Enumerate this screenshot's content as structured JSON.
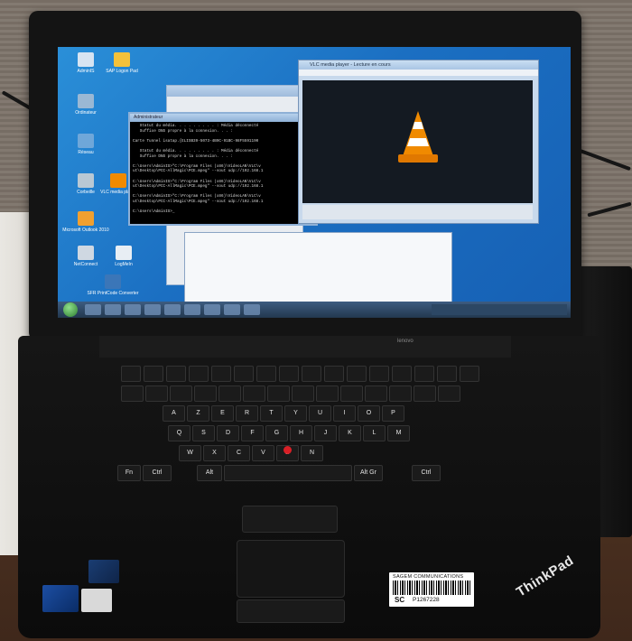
{
  "desktop": {
    "icons": [
      {
        "label": "AdminIS"
      },
      {
        "label": "SAP Logon Pad"
      },
      {
        "label": "Ordinateur"
      },
      {
        "label": "Réseau"
      },
      {
        "label": "Corbeille"
      },
      {
        "label": "Microsoft Outlook 2010"
      },
      {
        "label": "VLC media player"
      },
      {
        "label": "NetConnect"
      },
      {
        "label": "LogMeIn"
      },
      {
        "label": "SFR PrintCode Converter"
      }
    ]
  },
  "cmd": {
    "title": "Administrateur",
    "lines": [
      "   Statut du média. . . . . . . . . : Média déconnecté",
      "   Suffixe DNS propre à la connexion. . . :",
      "",
      "Carte Tunnel isatap.{ELISB39-5073-4B9C-91BC-98F5591190",
      "",
      "   Statut du média. . . . . . . . . : Média déconnecté",
      "   Suffixe DNS propre à la connexion. . . :",
      "",
      "C:\\Users\\AdminIS>\"C:\\Program Files (x86)\\VideoLAN\\VLC\\v",
      "ut\\Desktop\\PCC-AllMagic\\PCE.mpeg\" --sout udp://192.168.1",
      "",
      "C:\\Users\\AdminIS>\"C:\\Program Files (x86)\\VideoLAN\\VLC\\v",
      "ut\\Desktop\\PCC-AllMagic\\PCE.mpeg\" --sout udp://192.168.1",
      "",
      "C:\\Users\\AdminIS>\"C:\\Program Files (x86)\\VideoLAN\\VLC\\v",
      "ut\\Desktop\\PCC-AllMagic\\PCE.mpeg\" --sout udp://192.168.1",
      "",
      "C:\\Users\\AdminIS>_"
    ]
  },
  "vlc": {
    "title": "VLC media player - Lecture en cours"
  },
  "keyboard": {
    "row1": [
      "A",
      "Z",
      "E",
      "R",
      "T",
      "Y",
      "U",
      "I",
      "O",
      "P"
    ],
    "row2": [
      "Q",
      "S",
      "D",
      "F",
      "G",
      "H",
      "J",
      "K",
      "L",
      "M"
    ],
    "row3": [
      "W",
      "X",
      "C",
      "V",
      "B",
      "N"
    ],
    "bottom": [
      "Fn",
      "Ctrl",
      "Alt",
      "Alt Gr",
      "Ctrl"
    ]
  },
  "labels": {
    "barcode_top": "SAGEM COMMUNICATIONS",
    "barcode_sn": "SC",
    "barcode_num": "P1267228",
    "brand": "ThinkPad",
    "deck_brand": "lenovo"
  },
  "colors": {
    "desktop_blue": "#1b6fc2",
    "trackpoint_red": "#d91f26",
    "vlc_orange": "#f08a00"
  }
}
